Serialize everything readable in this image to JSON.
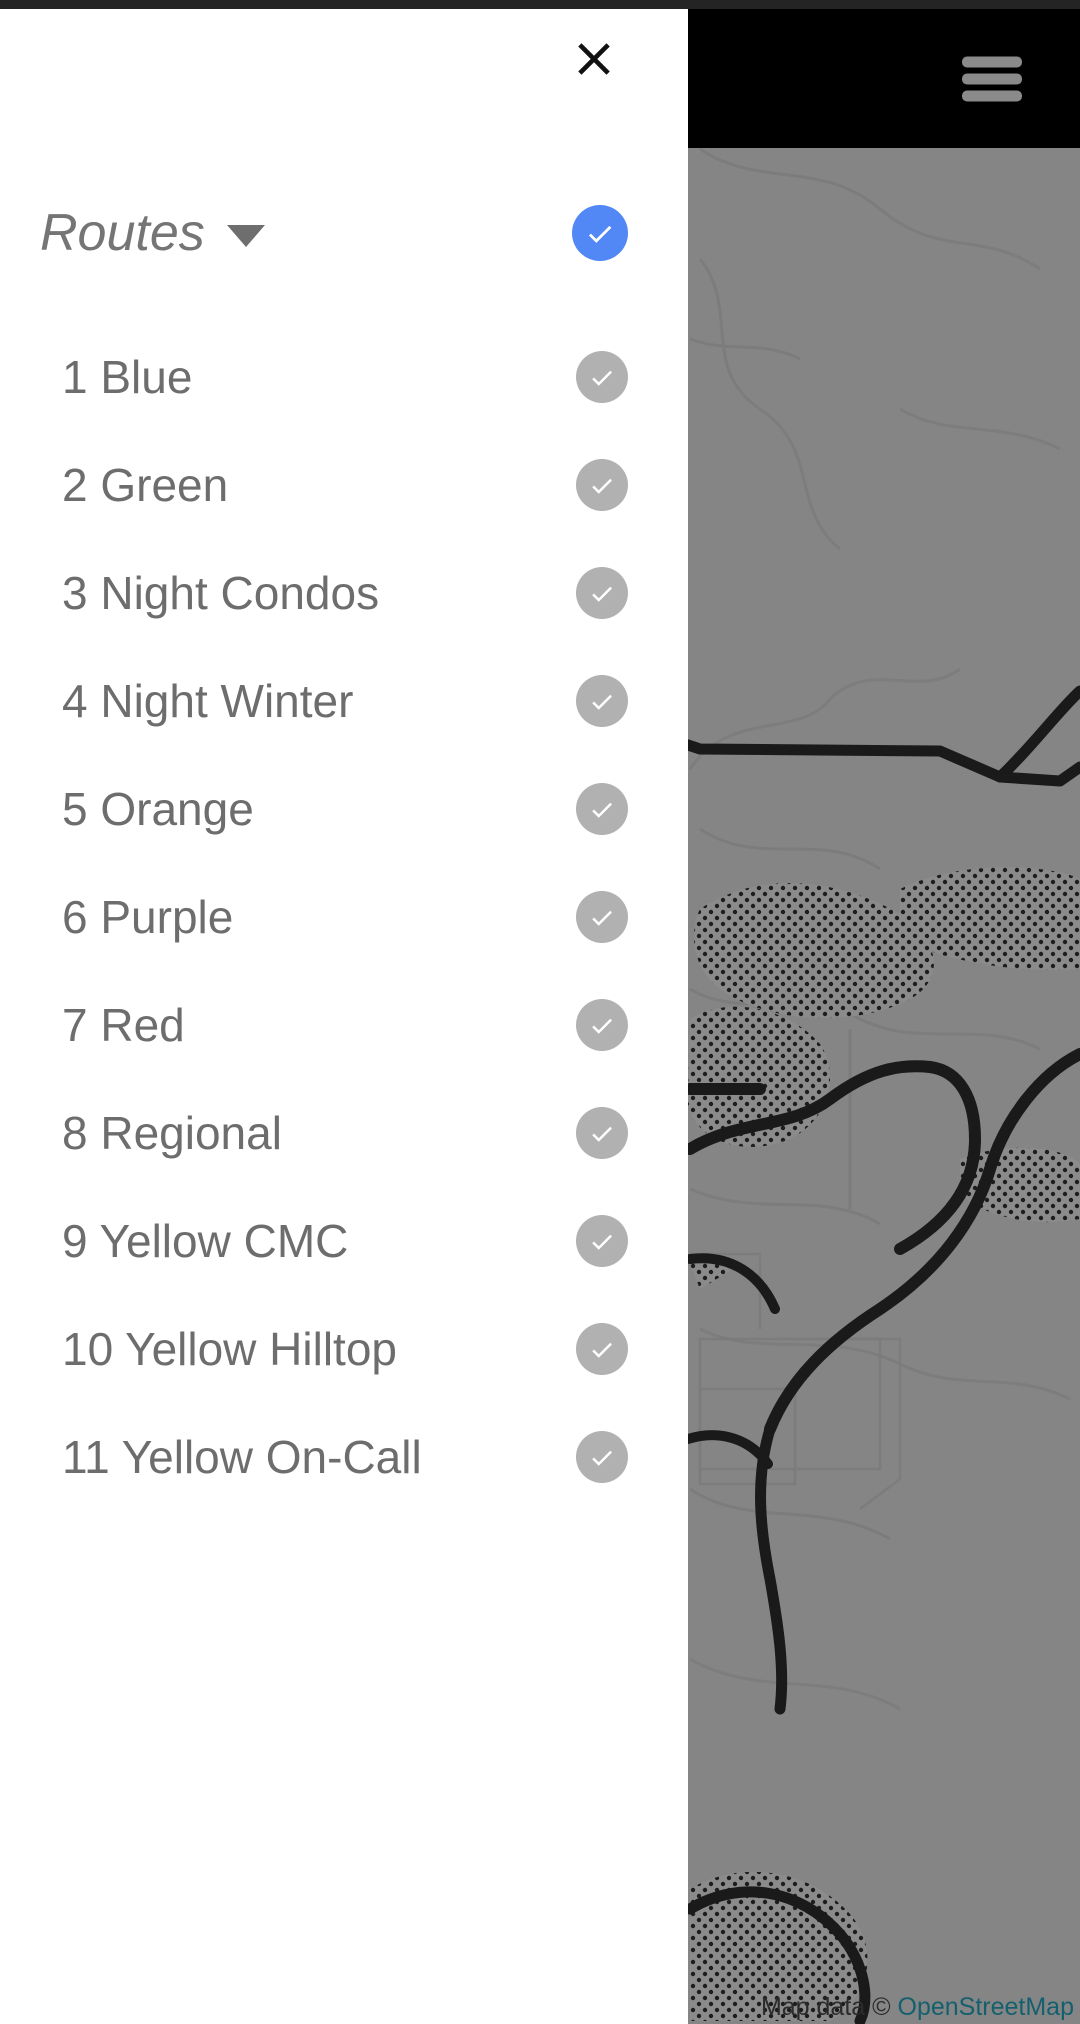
{
  "app": {
    "top_bar": {
      "menu_icon": "hamburger-menu-icon"
    }
  },
  "drawer": {
    "close_icon": "close-icon",
    "group": {
      "title": "Routes",
      "caret_icon": "chevron-down-icon",
      "checked": true,
      "check_color": "#5288f5",
      "check_icon": "check-circle-icon"
    },
    "routes": [
      {
        "label": "1 Blue",
        "checked": true
      },
      {
        "label": "2 Green",
        "checked": true
      },
      {
        "label": "3 Night Condos",
        "checked": true
      },
      {
        "label": "4 Night Winter",
        "checked": true
      },
      {
        "label": "5 Orange",
        "checked": true
      },
      {
        "label": "6 Purple",
        "checked": true
      },
      {
        "label": "7 Red",
        "checked": true
      },
      {
        "label": "8 Regional",
        "checked": true
      },
      {
        "label": "9 Yellow CMC",
        "checked": true
      },
      {
        "label": "10 Yellow Hilltop",
        "checked": true
      },
      {
        "label": "11 Yellow On-Call",
        "checked": true
      }
    ],
    "route_check_color": "#b1b1b1"
  },
  "map": {
    "attribution_prefix": "Map data © ",
    "attribution_link": "OpenStreetMap",
    "link_color": "#15606e",
    "background_color": "#858585"
  }
}
